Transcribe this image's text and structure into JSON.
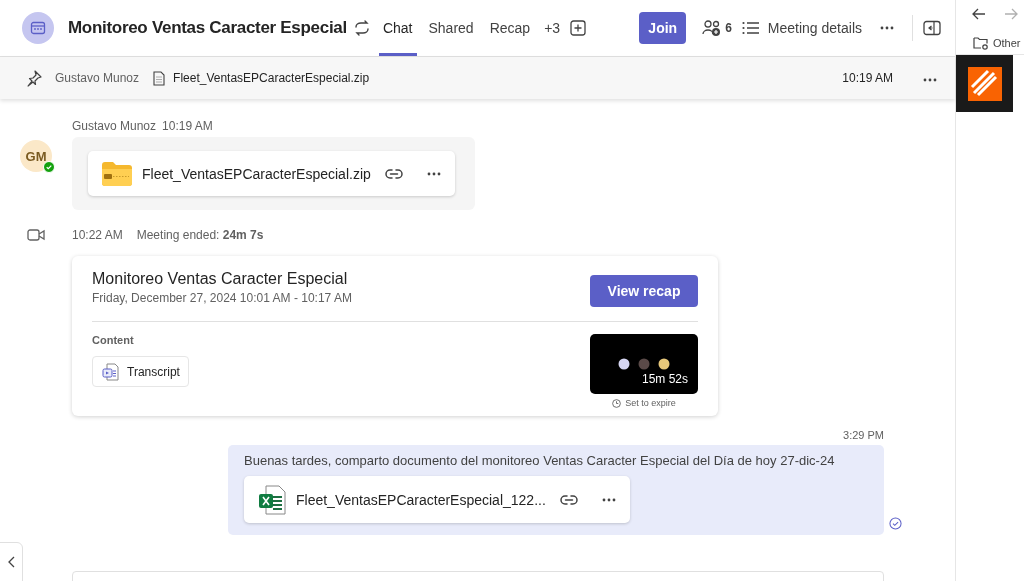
{
  "header": {
    "title": "Monitoreo Ventas Caracter Especial",
    "tabs": [
      {
        "label": "Chat",
        "selected": true
      },
      {
        "label": "Shared",
        "selected": false
      },
      {
        "label": "Recap",
        "selected": false
      }
    ],
    "more_tabs": "+3",
    "join_button": "Join",
    "participants_count": "6",
    "details_button": "Meeting details"
  },
  "pinned": {
    "author": "Gustavo Munoz",
    "file": "Fleet_VentasEPCaracterEspecial.zip",
    "time": "10:19 AM"
  },
  "messages": [
    {
      "kind": "file",
      "avatar": "GM",
      "online": true,
      "author": "Gustavo Munoz",
      "time": "10:19 AM",
      "attachment": {
        "kind": "zip",
        "name": "Fleet_VentasEPCaracterEspecial.zip"
      }
    },
    {
      "kind": "event",
      "time": "10:22 AM",
      "text": "Meeting ended: **24m 7s**"
    },
    {
      "kind": "meeting",
      "title": "Monitoreo Ventas Caracter Especial",
      "date": "Friday, December 27, 2024 10:01 AM - 10:17 AM",
      "button": "View recap",
      "content_label": "Content",
      "transcript": "Transcript",
      "duration": "15m 52s",
      "expire": "Set to expire"
    },
    {
      "kind": "own",
      "time": "3:29 PM",
      "text": "Buenas tardes, comparto documento del monitoreo  Ventas Caracter Especial del Día de hoy 27-dic-24",
      "attachment": {
        "kind": "excel",
        "name": "Fleet_VentasEPCaracterEspecial_122..."
      },
      "seen": true
    }
  ],
  "side_panel": {
    "folder_label": "Other"
  }
}
